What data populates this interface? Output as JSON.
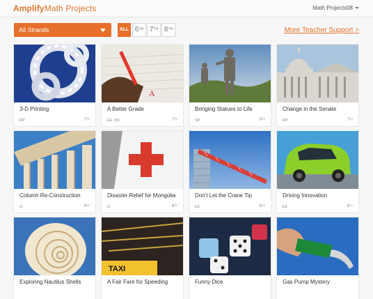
{
  "header": {
    "brand_bold": "Amplify",
    "brand_rest": "Math Projects",
    "user": "Math Projects08"
  },
  "controls": {
    "strand_select": "All Strands",
    "grades": [
      {
        "label": "ALL",
        "sup": ""
      },
      {
        "label": "6",
        "sup": "TH"
      },
      {
        "label": "7",
        "sup": "TH"
      },
      {
        "label": "8",
        "sup": "TH"
      }
    ],
    "support_link": "More Teacher Support >"
  },
  "projects": [
    {
      "title": "3-D Printing",
      "strand": "RP",
      "grade": "7",
      "grade_sup": "TH"
    },
    {
      "title": "A Better Grade",
      "strand": "EE, NS",
      "grade": "7",
      "grade_sup": "TH"
    },
    {
      "title": "Bringing Statues to Life",
      "strand": "SP",
      "grade": "8",
      "grade_sup": "TH"
    },
    {
      "title": "Change in the Senate",
      "strand": "RP",
      "grade": "7",
      "grade_sup": "TH"
    },
    {
      "title": "Column Re-Construction",
      "strand": "G",
      "grade": "8",
      "grade_sup": "TH"
    },
    {
      "title": "Disaster Relief for Mongolia",
      "strand": "G",
      "grade": "6",
      "grade_sup": "TH"
    },
    {
      "title": "Don't Let the Crane Tip",
      "strand": "EE",
      "grade": "6",
      "grade_sup": "TH"
    },
    {
      "title": "Driving Innovation",
      "strand": "EE",
      "grade": "8",
      "grade_sup": "TH"
    },
    {
      "title": "Exploring Nautilus Shells",
      "strand": "",
      "grade": "",
      "grade_sup": ""
    },
    {
      "title": "A Fair Fare for Speeding",
      "strand": "",
      "grade": "",
      "grade_sup": ""
    },
    {
      "title": "Funny Dice",
      "strand": "",
      "grade": "",
      "grade_sup": ""
    },
    {
      "title": "Gas Pump Mystery",
      "strand": "",
      "grade": "",
      "grade_sup": ""
    }
  ]
}
